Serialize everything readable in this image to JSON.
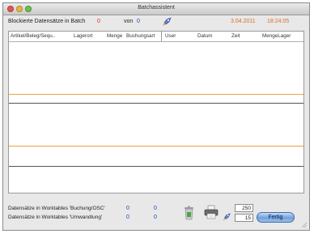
{
  "window": {
    "title": "Batchassistent"
  },
  "info": {
    "blocked_label": "Blockierte Datensätze in Batch",
    "blocked_count": "0",
    "von_label": "von",
    "total_count": "0",
    "date": "3.04.2011",
    "time": "18:24:05"
  },
  "table": {
    "columns": [
      "Artikel/Beleg/Sequ..",
      "Lagerort",
      "Menge",
      "Buchungsart",
      "User",
      "Datum",
      "Zeit",
      "MengeLager"
    ]
  },
  "bottom": {
    "row1_label": "Datensätze in Worktables 'Buchung/OSC'",
    "row1_val1": "0",
    "row1_val2": "0",
    "row2_label": "Datensätze in Worktables 'Umwandlung'",
    "row2_val1": "0",
    "row2_val2": "0"
  },
  "inputs": {
    "value1": "250",
    "value2": "15"
  },
  "button": {
    "label": "Fertig"
  },
  "colors": {
    "accent_red": "#dd2222",
    "accent_orange": "#e07020",
    "accent_blue": "#1e46b4",
    "separator_orange": "#f0a040"
  },
  "icons": [
    "rocket-icon",
    "trash-icon",
    "printer-icon",
    "resize-grip-icon"
  ]
}
